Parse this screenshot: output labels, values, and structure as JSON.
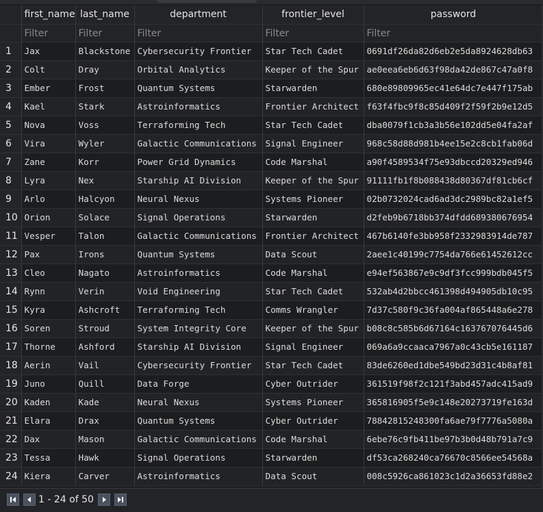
{
  "columns": [
    "first_name",
    "last_name",
    "department",
    "frontier_level",
    "password"
  ],
  "filter_placeholder": "Filter",
  "rows": [
    [
      "1",
      "Jax",
      "Blackstone",
      "Cybersecurity Frontier",
      "Star Tech Cadet",
      "0691df26da82d6eb2e5da8924628db63"
    ],
    [
      "2",
      "Colt",
      "Dray",
      "Orbital Analytics",
      "Keeper of the Spur",
      "ae0eea6eb6d63f98da42de867c47a0f8"
    ],
    [
      "3",
      "Ember",
      "Frost",
      "Quantum Systems",
      "Starwarden",
      "680e89809965ec41e64dc7e447f175ab"
    ],
    [
      "4",
      "Kael",
      "Stark",
      "Astroinformatics",
      "Frontier Architect",
      "f63f4fbc9f8c85d409f2f59f2b9e12d5"
    ],
    [
      "5",
      "Nova",
      "Voss",
      "Terraforming Tech",
      "Star Tech Cadet",
      "dba0079f1cb3a3b56e102dd5e04fa2af"
    ],
    [
      "6",
      "Vira",
      "Wyler",
      "Galactic Communications",
      "Signal Engineer",
      "968c58d88d981b4ee15e2c8cb1fab06d"
    ],
    [
      "7",
      "Zane",
      "Korr",
      "Power Grid Dynamics",
      "Code Marshal",
      "a90f4589534f75e93dbccd20329ed946"
    ],
    [
      "8",
      "Lyra",
      "Nex",
      "Starship AI Division",
      "Keeper of the Spur",
      "91111fb1f8b088438d80367df81cb6cf"
    ],
    [
      "9",
      "Arlo",
      "Halcyon",
      "Neural Nexus",
      "Systems Pioneer",
      "02b0732024cad6ad3dc2989bc82a1ef5"
    ],
    [
      "10",
      "Orion",
      "Solace",
      "Signal Operations",
      "Starwarden",
      "d2feb9b6718bb374dfdd689380676954"
    ],
    [
      "11",
      "Vesper",
      "Talon",
      "Galactic Communications",
      "Frontier Architect",
      "467b6140fe3bb958f2332983914de787"
    ],
    [
      "12",
      "Pax",
      "Irons",
      "Quantum Systems",
      "Data Scout",
      "2aee1c40199c7754da766e61452612cc"
    ],
    [
      "13",
      "Cleo",
      "Nagato",
      "Astroinformatics",
      "Code Marshal",
      "e94ef563867e9c9df3fcc999bdb045f5"
    ],
    [
      "14",
      "Rynn",
      "Verin",
      "Void Engineering",
      "Star Tech Cadet",
      "532ab4d2bbcc461398d494905db10c95"
    ],
    [
      "15",
      "Kyra",
      "Ashcroft",
      "Terraforming Tech",
      "Comms Wrangler",
      "7d37c580f9c36fa004af865448a6e278"
    ],
    [
      "16",
      "Soren",
      "Stroud",
      "System Integrity Core",
      "Keeper of the Spur",
      "b08c8c585b6d67164c163767076445d6"
    ],
    [
      "17",
      "Thorne",
      "Ashford",
      "Starship AI Division",
      "Signal Engineer",
      "069a6a9ccaaca7967a0c43cb5e161187"
    ],
    [
      "18",
      "Aerin",
      "Vail",
      "Cybersecurity Frontier",
      "Star Tech Cadet",
      "83de6260ed1dbe549bd23d31c4b8af81"
    ],
    [
      "19",
      "Juno",
      "Quill",
      "Data Forge",
      "Cyber Outrider",
      "361519f98f2c121f3abd457adc415ad9"
    ],
    [
      "20",
      "Kaden",
      "Kade",
      "Neural Nexus",
      "Systems Pioneer",
      "365816905f5e9c148e20273719fe163d"
    ],
    [
      "21",
      "Elara",
      "Drax",
      "Quantum Systems",
      "Cyber Outrider",
      "78842815248300fa6ae79f7776a5080a"
    ],
    [
      "22",
      "Dax",
      "Mason",
      "Galactic Communications",
      "Code Marshal",
      "6ebe76c9fb411be97b3b0d48b791a7c9"
    ],
    [
      "23",
      "Tessa",
      "Hawk",
      "Signal Operations",
      "Starwarden",
      "df53ca268240ca76670c8566ee54568a"
    ],
    [
      "24",
      "Kiera",
      "Carver",
      "Astroinformatics",
      "Data Scout",
      "008c5926ca861023c1d2a36653fd88e2"
    ]
  ],
  "pager": {
    "info": "1 - 24 of 50",
    "first_icon": "first-page-icon",
    "prev_icon": "prev-page-icon",
    "next_icon": "next-page-icon",
    "last_icon": "last-page-icon"
  },
  "colors": {
    "background": "#1e1f21",
    "header_bg": "#232427",
    "button_bg": "#4a5260"
  }
}
